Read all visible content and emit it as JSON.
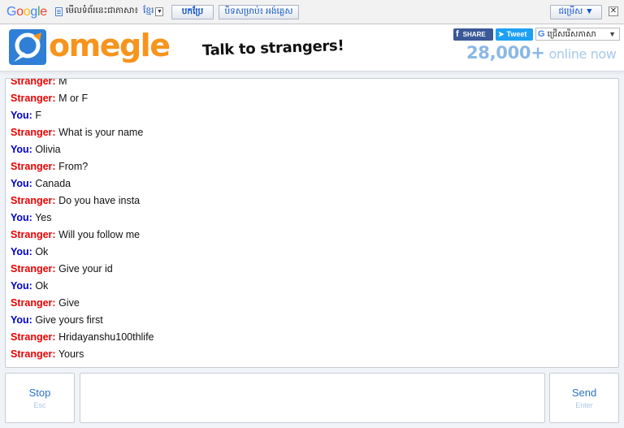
{
  "translate_bar": {
    "google_logo": "Google",
    "prompt": "មើលទំព័រនេះជាភាសា៖",
    "language": "ខ្មែរ",
    "translate_label": "បកប្រែ",
    "show_original_label": "បិទសម្រាប់៖ អង់គ្លេស",
    "options_label": "ជម្រើស ▼",
    "close_label": "✕"
  },
  "header": {
    "logo_text": "omegle",
    "tagline": "Talk to strangers!",
    "facebook_label": "SHARE",
    "tweet_label": "Tweet",
    "language_select": "ជ្រើសរើសភាសា",
    "online_count": "28,000+",
    "online_label": "online now"
  },
  "chat": {
    "messages": [
      {
        "who": "Stranger:",
        "role": "stranger",
        "text": "M"
      },
      {
        "who": "Stranger:",
        "role": "stranger",
        "text": "M or F"
      },
      {
        "who": "You:",
        "role": "you",
        "text": "F"
      },
      {
        "who": "Stranger:",
        "role": "stranger",
        "text": "What is your name"
      },
      {
        "who": "You:",
        "role": "you",
        "text": "Olivia"
      },
      {
        "who": "Stranger:",
        "role": "stranger",
        "text": "From?"
      },
      {
        "who": "You:",
        "role": "you",
        "text": "Canada"
      },
      {
        "who": "Stranger:",
        "role": "stranger",
        "text": "Do you have insta"
      },
      {
        "who": "You:",
        "role": "you",
        "text": "Yes"
      },
      {
        "who": "Stranger:",
        "role": "stranger",
        "text": "Will you follow me"
      },
      {
        "who": "You:",
        "role": "you",
        "text": "Ok"
      },
      {
        "who": "Stranger:",
        "role": "stranger",
        "text": "Give your id"
      },
      {
        "who": "You:",
        "role": "you",
        "text": "Ok"
      },
      {
        "who": "Stranger:",
        "role": "stranger",
        "text": "Give"
      },
      {
        "who": "You:",
        "role": "you",
        "text": "Give yours first"
      },
      {
        "who": "Stranger:",
        "role": "stranger",
        "text": "Hridayanshu100thlife"
      },
      {
        "who": "Stranger:",
        "role": "stranger",
        "text": "Yours"
      }
    ]
  },
  "controls": {
    "stop_label": "Stop",
    "stop_key": "Esc",
    "send_label": "Send",
    "send_key": "Enter",
    "compose_value": ""
  },
  "colors": {
    "stranger": "#ee0000",
    "you": "#0000cc",
    "brand_orange": "#f7941d",
    "brand_blue": "#2a73c7"
  }
}
